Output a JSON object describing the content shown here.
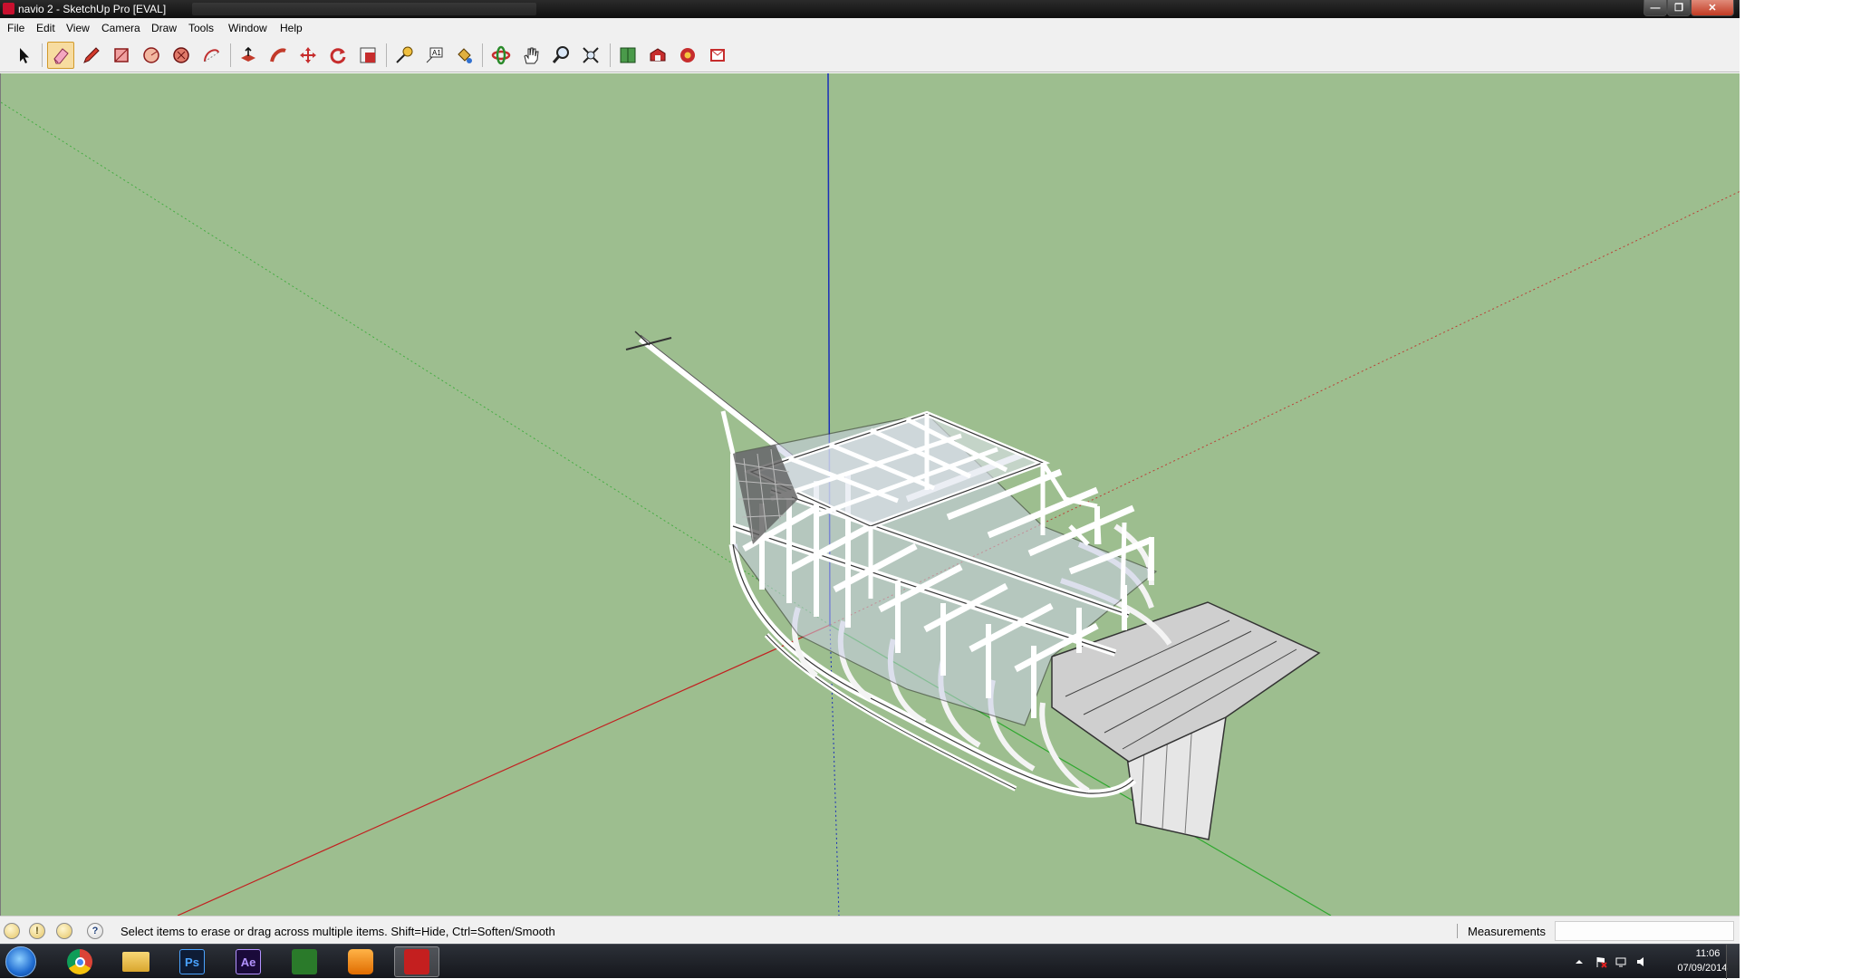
{
  "window": {
    "title": "navio 2 - SketchUp Pro [EVAL]",
    "minimize_label": "—",
    "maximize_label": "❐",
    "close_label": "✕"
  },
  "menu": [
    {
      "label": "File"
    },
    {
      "label": "Edit"
    },
    {
      "label": "View"
    },
    {
      "label": "Camera"
    },
    {
      "label": "Draw"
    },
    {
      "label": "Tools"
    },
    {
      "label": "Window"
    },
    {
      "label": "Help"
    }
  ],
  "toolbar": {
    "tools": [
      {
        "name": "select-tool",
        "icon": "arrow-icon"
      },
      {
        "name": "eraser-tool",
        "icon": "eraser-icon",
        "active": true
      },
      {
        "name": "pencil-tool",
        "icon": "pencil-icon"
      },
      {
        "name": "rectangle-tool",
        "icon": "rectangle-icon"
      },
      {
        "name": "circle-tool",
        "icon": "circle-icon"
      },
      {
        "name": "polygon-tool",
        "icon": "polygon-icon"
      },
      {
        "name": "arc-tool",
        "icon": "arc-icon"
      },
      {
        "name": "push-pull-tool",
        "icon": "push-pull-icon"
      },
      {
        "name": "follow-me-tool",
        "icon": "follow-me-icon"
      },
      {
        "name": "move-tool",
        "icon": "move-icon"
      },
      {
        "name": "rotate-tool",
        "icon": "rotate-icon"
      },
      {
        "name": "scale-tool",
        "icon": "scale-icon"
      },
      {
        "name": "tape-measure-tool",
        "icon": "tape-measure-icon"
      },
      {
        "name": "text-tool",
        "icon": "text-icon"
      },
      {
        "name": "paint-bucket-tool",
        "icon": "paint-bucket-icon"
      },
      {
        "name": "orbit-tool",
        "icon": "orbit-icon"
      },
      {
        "name": "pan-tool",
        "icon": "hand-icon"
      },
      {
        "name": "zoom-tool",
        "icon": "magnifier-icon"
      },
      {
        "name": "zoom-extents-tool",
        "icon": "zoom-extents-icon"
      },
      {
        "name": "add-location-tool",
        "icon": "map-icon"
      },
      {
        "name": "get-models-tool",
        "icon": "warehouse-icon"
      },
      {
        "name": "share-model-tool",
        "icon": "share-icon"
      },
      {
        "name": "extension-warehouse-tool",
        "icon": "extension-icon"
      }
    ]
  },
  "colors": {
    "viewport_background": "#9dbe8f",
    "red_axis": "#c22020",
    "green_axis": "#2ea82e",
    "blue_axis": "#1a2fb8",
    "accent_active_tool": "#f7dca0"
  },
  "status": {
    "hint": "Select items to erase or drag across multiple items. Shift=Hide, Ctrl=Soften/Smooth",
    "measurements_label": "Measurements",
    "measurements_value": "",
    "icons": [
      "geolocation-icon",
      "credits-icon",
      "user-icon",
      "help-icon"
    ]
  },
  "taskbar": {
    "apps": [
      {
        "name": "chrome",
        "label": ""
      },
      {
        "name": "explorer",
        "label": ""
      },
      {
        "name": "photoshop",
        "label": "Ps"
      },
      {
        "name": "aftereffects",
        "label": "Ae"
      },
      {
        "name": "sketchbook",
        "label": ""
      },
      {
        "name": "media",
        "label": ""
      },
      {
        "name": "sketchup",
        "label": "",
        "active": true
      }
    ],
    "time": "11:06",
    "date": "07/09/2014"
  }
}
